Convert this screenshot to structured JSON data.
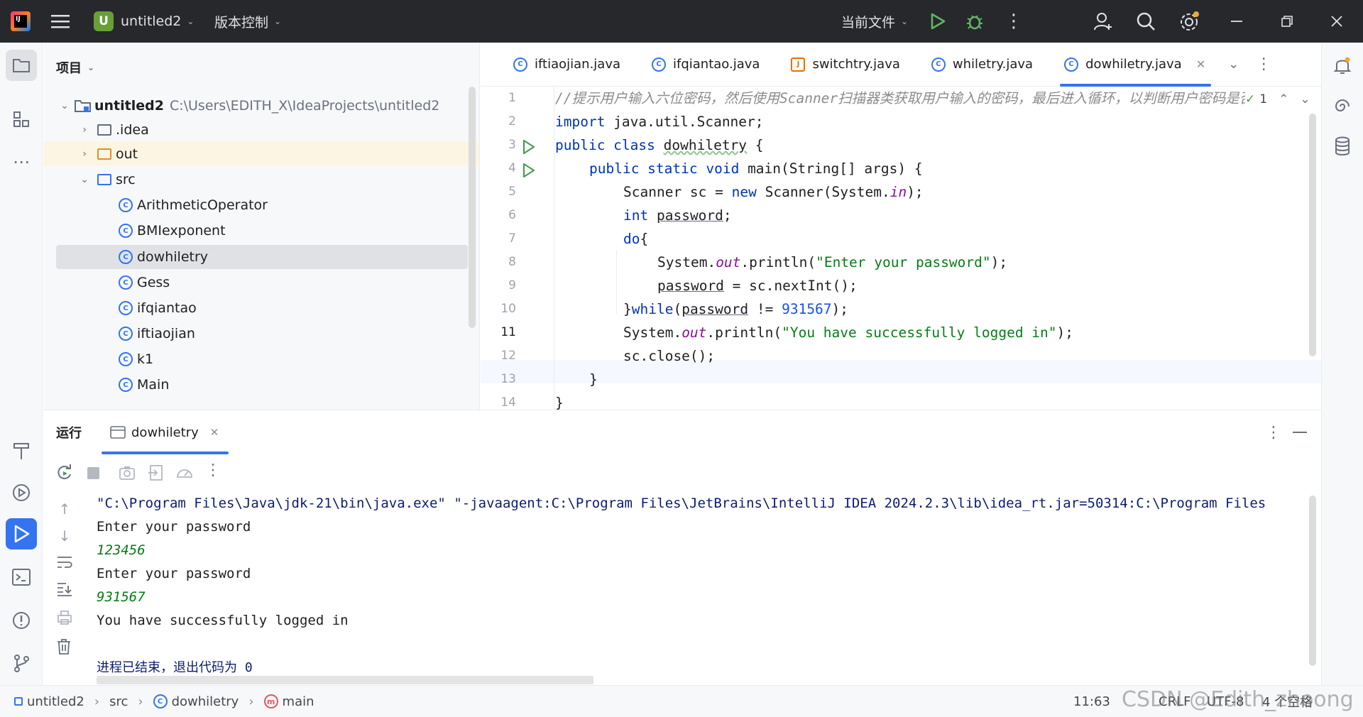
{
  "titlebar": {
    "project_initial": "U",
    "project_name": "untitled2",
    "vcs_label": "版本控制",
    "run_config": "当前文件"
  },
  "project_panel": {
    "title": "项目",
    "root_name": "untitled2",
    "root_path": "C:\\Users\\EDITH_X\\IdeaProjects\\untitled2",
    "items": [
      {
        "label": ".idea",
        "type": "folder"
      },
      {
        "label": "out",
        "type": "folder-excluded"
      },
      {
        "label": "src",
        "type": "folder"
      },
      {
        "label": "ArithmeticOperator",
        "type": "class"
      },
      {
        "label": "BMIexponent",
        "type": "class"
      },
      {
        "label": "dowhiletry",
        "type": "class"
      },
      {
        "label": "Gess",
        "type": "class"
      },
      {
        "label": "ifqiantao",
        "type": "class"
      },
      {
        "label": "iftiaojian",
        "type": "class"
      },
      {
        "label": "k1",
        "type": "class"
      },
      {
        "label": "Main",
        "type": "class"
      }
    ]
  },
  "editor": {
    "tabs": [
      {
        "label": "iftiaojian.java"
      },
      {
        "label": "ifqiantao.java"
      },
      {
        "label": "switchtry.java"
      },
      {
        "label": "whiletry.java"
      },
      {
        "label": "dowhiletry.java"
      }
    ],
    "inspection_count": "1",
    "line_numbers": [
      "1",
      "2",
      "3",
      "4",
      "5",
      "6",
      "7",
      "8",
      "9",
      "10",
      "11",
      "12",
      "13",
      "14"
    ],
    "current_line": "11",
    "code": {
      "l1_comment": "//提示用户输入六位密码，然后使用Scanner扫描器类获取用户输入的密码，最后进入循环，以判断用户密码是否",
      "l2_kw": "import",
      "l2_rest": " java.util.Scanner;",
      "l3_kw": "public class",
      "l3_name": "dowhiletry",
      "l3_rest": " {",
      "l4_kw": "public static void",
      "l4_rest": " main(String[] args) {",
      "l5_a": "Scanner sc = ",
      "l5_kw": "new",
      "l5_b": " Scanner(System.",
      "l5_field": "in",
      "l5_c": ");",
      "l6_kw": "int",
      "l6_var": "password",
      "l6_rest": ";",
      "l7_kw": "do",
      "l7_rest": "{",
      "l8_a": "System.",
      "l8_field": "out",
      "l8_b": ".println(",
      "l8_str": "\"Enter your password\"",
      "l8_c": ");",
      "l9_var": "password",
      "l9_rest": " = sc.nextInt();",
      "l10_a": "}",
      "l10_kw": "while",
      "l10_b": "(",
      "l10_var": "password",
      "l10_c": " != ",
      "l10_num": "931567",
      "l10_d": ");",
      "l11_a": "System.",
      "l11_field": "out",
      "l11_b": ".println(",
      "l11_str": "\"You have successfully logged in\"",
      "l11_c": ");",
      "l12": "sc.close();",
      "l13": "}",
      "l14": "}"
    }
  },
  "run_panel": {
    "title": "运行",
    "tab_label": "dowhiletry",
    "console": {
      "command": "\"C:\\Program Files\\Java\\jdk-21\\bin\\java.exe\" \"-javaagent:C:\\Program Files\\JetBrains\\IntelliJ IDEA 2024.2.3\\lib\\idea_rt.jar=50314:C:\\Program Files",
      "prompt1": "Enter your password",
      "input1": "123456",
      "prompt2": "Enter your password",
      "input2": "931567",
      "success": "You have successfully logged in",
      "exit": "进程已结束，退出代码为 0"
    }
  },
  "statusbar": {
    "crumbs": [
      "untitled2",
      "src",
      "dowhiletry",
      "main"
    ],
    "position": "11:63",
    "line_sep": "CRLF",
    "encoding": "UTF-8",
    "indent": "4 个空格",
    "watermark": "CSDN @Edith_zhoong"
  },
  "colors": {
    "accent": "#3574f0",
    "run_green": "#499c54",
    "keyword": "#0033b3",
    "string": "#067d17"
  }
}
